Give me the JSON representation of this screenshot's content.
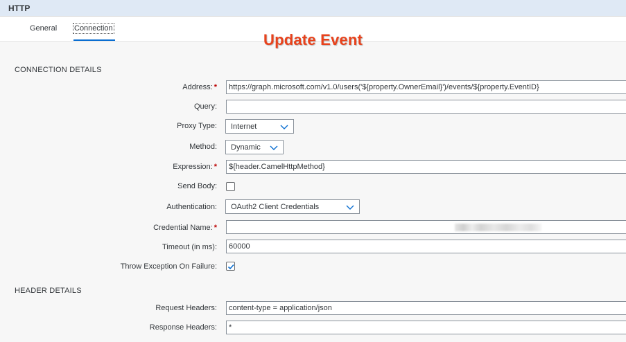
{
  "window": {
    "title": "HTTP"
  },
  "tabs": [
    {
      "label": "General",
      "active": false
    },
    {
      "label": "Connection",
      "active": true
    }
  ],
  "overlay": {
    "title": "Update Event",
    "color": "#e8421c"
  },
  "connection": {
    "section_title": "CONNECTION DETAILS",
    "address": {
      "label": "Address:",
      "value": "https://graph.microsoft.com/v1.0/users('${property.OwnerEmail}')/events/${property.EventID}"
    },
    "query": {
      "label": "Query:",
      "value": ""
    },
    "proxy_type": {
      "label": "Proxy Type:",
      "selected": "Internet"
    },
    "method": {
      "label": "Method:",
      "selected": "Dynamic"
    },
    "expression": {
      "label": "Expression:",
      "value": "${header.CamelHttpMethod}"
    },
    "send_body": {
      "label": "Send Body:",
      "checked": false
    },
    "authentication": {
      "label": "Authentication:",
      "selected": "OAuth2 Client Credentials"
    },
    "credential_name": {
      "label": "Credential Name:",
      "value_redacted": true
    },
    "timeout": {
      "label": "Timeout (in ms):",
      "value": "60000"
    },
    "throw_exception": {
      "label": "Throw Exception On Failure:",
      "checked": true
    }
  },
  "header": {
    "section_title": "HEADER DETAILS",
    "request_headers": {
      "label": "Request Headers:",
      "value": "content-type = application/json"
    },
    "response_headers": {
      "label": "Response Headers:",
      "value": "*"
    }
  },
  "required_marker": "*",
  "colors": {
    "accent": "#0a6ed1",
    "title_bar": "#dfe9f5",
    "required": "#bb0000"
  }
}
